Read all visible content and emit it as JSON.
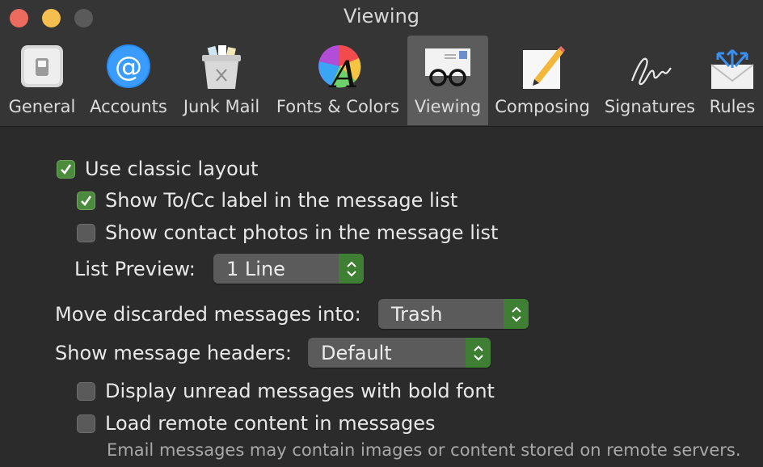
{
  "window": {
    "title": "Viewing"
  },
  "toolbar": {
    "tabs": [
      {
        "label": "General",
        "icon": "general-switch-icon"
      },
      {
        "label": "Accounts",
        "icon": "at-sign-icon"
      },
      {
        "label": "Junk Mail",
        "icon": "junk-trash-icon"
      },
      {
        "label": "Fonts & Colors",
        "icon": "font-color-wheel-icon"
      },
      {
        "label": "Viewing",
        "icon": "glasses-envelope-icon",
        "active": true
      },
      {
        "label": "Composing",
        "icon": "pencil-paper-icon"
      },
      {
        "label": "Signatures",
        "icon": "signature-icon"
      },
      {
        "label": "Rules",
        "icon": "rules-envelope-icon"
      }
    ]
  },
  "viewing": {
    "use_classic_layout": {
      "label": "Use classic layout",
      "checked": true
    },
    "show_to_cc": {
      "label": "Show To/Cc label in the message list",
      "checked": true
    },
    "show_contact_photos": {
      "label": "Show contact photos in the message list",
      "checked": false
    },
    "list_preview": {
      "label": "List Preview:",
      "value": "1 Line"
    },
    "move_discarded": {
      "label": "Move discarded messages into:",
      "value": "Trash"
    },
    "show_headers": {
      "label": "Show message headers:",
      "value": "Default"
    },
    "bold_unread": {
      "label": "Display unread messages with bold font",
      "checked": false
    },
    "load_remote": {
      "label": "Load remote content in messages",
      "checked": false
    },
    "remote_note": "Email messages may contain images or content stored on remote servers."
  },
  "colors": {
    "accent_green": "#3f7f33",
    "checkbox_green": "#4c8b3d"
  }
}
